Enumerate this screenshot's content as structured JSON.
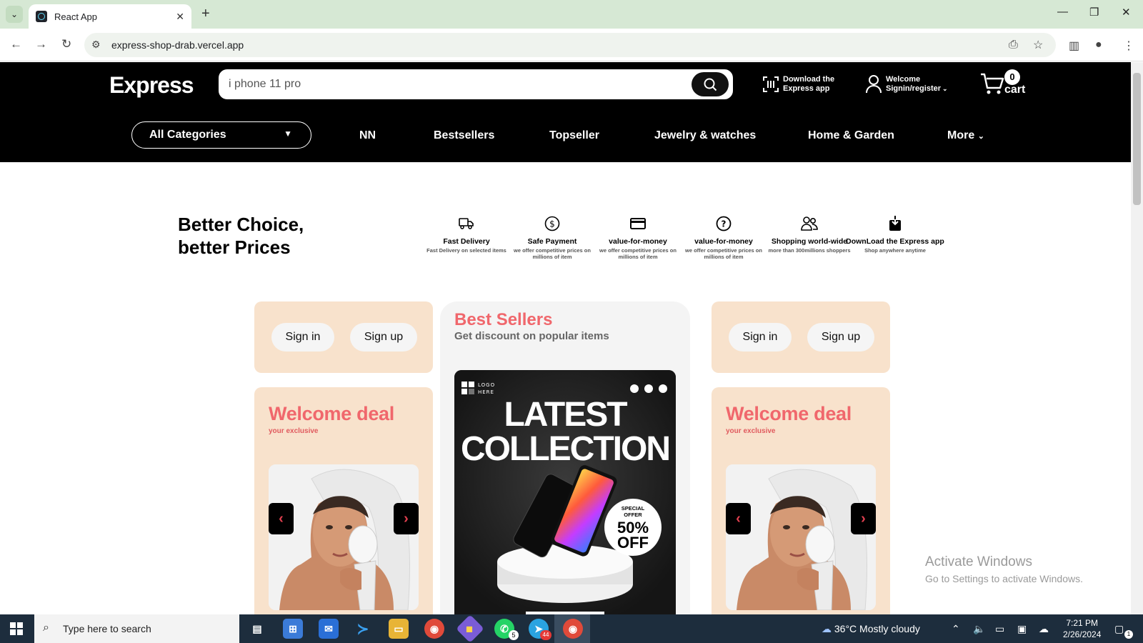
{
  "browser": {
    "tab_title": "React App",
    "url": "express-shop-drab.vercel.app"
  },
  "site": {
    "logo": "Express",
    "search_value": "i phone 11 pro",
    "download_line1": "Download the",
    "download_line2": "Express app",
    "welcome_line1": "Welcome",
    "welcome_line2": "Signin/register",
    "cart_count": "0",
    "cart_label": "cart",
    "category_select": "All Categories",
    "nav": [
      "NN",
      "Bestsellers",
      "Topseller",
      "Jewelry & watches",
      "Home & Garden",
      "More"
    ]
  },
  "tagline": {
    "line1": "Better Choice,",
    "line2": "better Prices"
  },
  "features": [
    {
      "icon": "truck-icon",
      "title": "Fast Delivery",
      "desc": "Fast Delivery on selected items"
    },
    {
      "icon": "dollar-icon",
      "title": "Safe Payment",
      "desc": "we offer competitive prices on millions of item"
    },
    {
      "icon": "card-icon",
      "title": "value-for-money",
      "desc": "we offer competitive prices on millions of item"
    },
    {
      "icon": "question-icon",
      "title": "value-for-money",
      "desc": "we offer competitive prices on millions of item"
    },
    {
      "icon": "users-icon",
      "title": "Shopping world-wide",
      "desc": "more than 300millions shoppers"
    },
    {
      "icon": "download-icon",
      "title": "DownLoad the Express app",
      "desc": "Shop anywhere anytime"
    }
  ],
  "auth": {
    "signin": "Sign in",
    "signup": "Sign up"
  },
  "deal": {
    "title": "Welcome deal",
    "subtitle": "your exclusive"
  },
  "bestsellers": {
    "title": "Best Sellers",
    "subtitle": "Get discount on popular items",
    "poster_logo1": "LOGO",
    "poster_logo2": "HERE",
    "poster_line1": "LATEST",
    "poster_line2": "COLLECTION",
    "offer_line1": "SPECIAL",
    "offer_line2": "OFFER",
    "offer_line3": "50%",
    "offer_line4": "OFF"
  },
  "watermark": {
    "line1": "Activate Windows",
    "line2": "Go to Settings to activate Windows."
  },
  "taskbar": {
    "search_placeholder": "Type here to search",
    "weather": "36°C  Mostly cloudy",
    "time": "7:21 PM",
    "date": "2/26/2024",
    "whatsapp_badge": "5",
    "telegram_badge": "44",
    "notif_badge": "1"
  },
  "colors": {
    "accent": "#f0676c",
    "card_bg": "#f8e2cc",
    "header_bg": "#000000"
  }
}
